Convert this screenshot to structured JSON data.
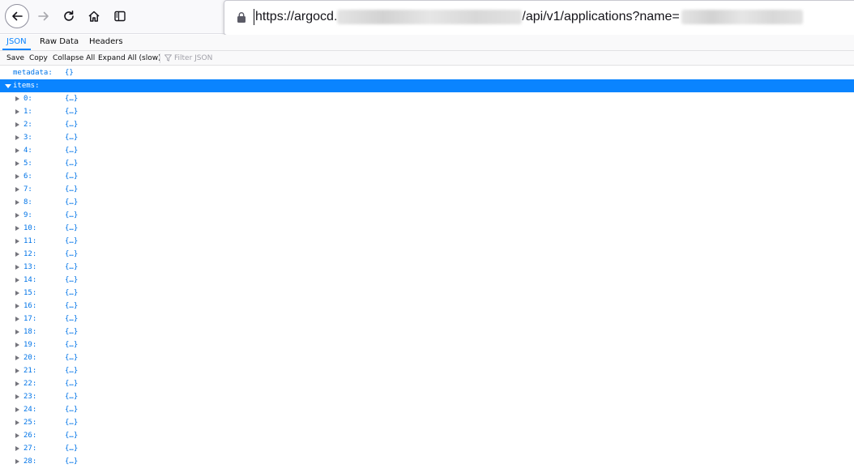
{
  "browser": {
    "url_prefix": "https://argocd.",
    "url_path": "/api/v1/applications?name="
  },
  "viewer": {
    "tabs": {
      "json": "JSON",
      "raw": "Raw Data",
      "headers": "Headers"
    },
    "toolbar": {
      "save": "Save",
      "copy": "Copy",
      "collapse_all": "Collapse All",
      "expand_all": "Expand All (slow)",
      "filter_placeholder": "Filter JSON"
    },
    "accent_color": "#0a84ff",
    "tree": {
      "metadata": {
        "key": "metadata:",
        "value": "{}"
      },
      "items": {
        "key": "items:"
      },
      "item_rows": [
        {
          "key": "0:",
          "value": "{…}"
        },
        {
          "key": "1:",
          "value": "{…}"
        },
        {
          "key": "2:",
          "value": "{…}"
        },
        {
          "key": "3:",
          "value": "{…}"
        },
        {
          "key": "4:",
          "value": "{…}"
        },
        {
          "key": "5:",
          "value": "{…}"
        },
        {
          "key": "6:",
          "value": "{…}"
        },
        {
          "key": "7:",
          "value": "{…}"
        },
        {
          "key": "8:",
          "value": "{…}"
        },
        {
          "key": "9:",
          "value": "{…}"
        },
        {
          "key": "10:",
          "value": "{…}"
        },
        {
          "key": "11:",
          "value": "{…}"
        },
        {
          "key": "12:",
          "value": "{…}"
        },
        {
          "key": "13:",
          "value": "{…}"
        },
        {
          "key": "14:",
          "value": "{…}"
        },
        {
          "key": "15:",
          "value": "{…}"
        },
        {
          "key": "16:",
          "value": "{…}"
        },
        {
          "key": "17:",
          "value": "{…}"
        },
        {
          "key": "18:",
          "value": "{…}"
        },
        {
          "key": "19:",
          "value": "{…}"
        },
        {
          "key": "20:",
          "value": "{…}"
        },
        {
          "key": "21:",
          "value": "{…}"
        },
        {
          "key": "22:",
          "value": "{…}"
        },
        {
          "key": "23:",
          "value": "{…}"
        },
        {
          "key": "24:",
          "value": "{…}"
        },
        {
          "key": "25:",
          "value": "{…}"
        },
        {
          "key": "26:",
          "value": "{…}"
        },
        {
          "key": "27:",
          "value": "{…}"
        },
        {
          "key": "28:",
          "value": "{…}"
        }
      ]
    }
  }
}
